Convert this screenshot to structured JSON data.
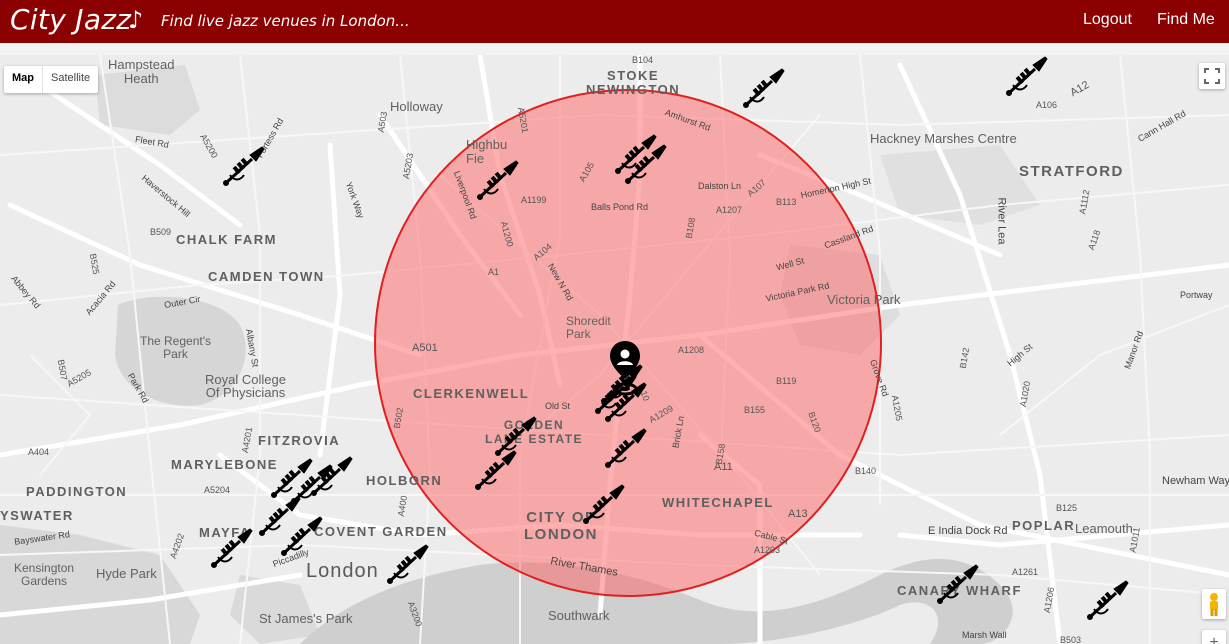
{
  "header": {
    "title": "City Jazz",
    "note_glyph": "♪",
    "tagline": "Find live jazz venues in London...",
    "logout_label": "Logout",
    "findme_label": "Find Me",
    "bar_color": "#8b0000"
  },
  "map_controls": {
    "map_label": "Map",
    "satellite_label": "Satellite"
  },
  "search_radius": {
    "fill_color": "#ff6464",
    "stroke_color": "#e02020"
  },
  "map_labels": {
    "hampstead_heath": "Hampstead\nHeath",
    "holloway": "Holloway",
    "stoke_newington": "STOKE\nNEWINGTON",
    "hackney_marshes": "Hackney Marshes Centre",
    "stratford": "STRATFORD",
    "chalk_farm": "CHALK FARM",
    "camden_town": "CAMDEN TOWN",
    "highbury_fields": "Highbu\nFie",
    "regents_park": "The Regent's\nPark",
    "royal_college": "Royal College\nOf Physicians",
    "shoreditch_park": "Shoredit\nPark",
    "victoria_park": "Victoria Park",
    "clerkenwell": "CLERKENWELL",
    "golden_lane": "GOLDEN\nLANE ESTATE",
    "fitzrovia": "FITZROVIA",
    "marylebone": "MARYLEBONE",
    "paddington": "PADDINGTON",
    "holborn": "HOLBORN",
    "bayswater": "YSWATER",
    "mayfair": "MAYFA",
    "covent_garden": "COVENT GARDEN",
    "city_of_london": "CITY OF\nLONDON",
    "whitechapel": "WHITECHAPEL",
    "london": "London",
    "kensington_gardens": "Kensington\nGardens",
    "hyde_park": "Hyde Park",
    "st_james_park": "St James's Park",
    "southwark": "Southwark",
    "poplar": "POPLAR",
    "leamouth": "Leamouth",
    "canary_wharf": "CANARY WHARF",
    "river_thames": "River Thames",
    "newham_way": "Newham Way",
    "river_lea": "River Lea",
    "piccadilly": "Piccadilly",
    "e_india_dock_rd": "E India Dock Rd",
    "marsh_wall": "Marsh Wall",
    "cable_st": "Cable St",
    "balls_pond_rd": "Balls Pond Rd",
    "dalston_ln": "Dalston Ln",
    "victoria_park_rd": "Victoria Park Rd",
    "well_st": "Well St",
    "old_st": "Old St",
    "brick_ln": "Brick Ln",
    "amhurst_rd": "Amhurst Rd",
    "homerton_high_st": "Homerton High St",
    "cassland_rd": "Cassland Rd",
    "high_st": "High St",
    "manor_rd": "Manor Rd",
    "portway": "Portway",
    "cann_hall_rd": "Cann Hall Rd",
    "fleet_rd": "Fleet Rd",
    "fortess_rd": "Fortess Rd",
    "haverstock_hill": "Haverstock Hill",
    "york_way": "York Way",
    "outer_cir": "Outer Cir",
    "park_rd": "Park Rd",
    "albany_st": "Albany St",
    "liverpool_rd": "Liverpool Rd",
    "new_n_rd": "New N Rd",
    "bayswater_rd": "Bayswater Rd",
    "acacia_rd": "Acacia Rd",
    "abbey_rd": "Abbey Rd",
    "grove_rd": "Grove Rd"
  },
  "road_numbers": [
    "A1",
    "A10",
    "A11",
    "A13",
    "A12",
    "A501",
    "A5201",
    "A104",
    "A105",
    "A107",
    "A1199",
    "A1200",
    "A1207",
    "A1208",
    "A1209",
    "A1203",
    "A1261",
    "A1205",
    "A1206",
    "A5205",
    "A4202",
    "A404",
    "A4201",
    "A5204",
    "A400",
    "A5200",
    "A503",
    "A5203",
    "A3200",
    "A1011",
    "A1020",
    "A1112",
    "A118",
    "A106",
    "B104",
    "B108",
    "B113",
    "B119",
    "B120",
    "B125",
    "B140",
    "B142",
    "B155",
    "B158",
    "B507",
    "B509",
    "B525",
    "B502",
    "B503"
  ],
  "venue_count": 20
}
